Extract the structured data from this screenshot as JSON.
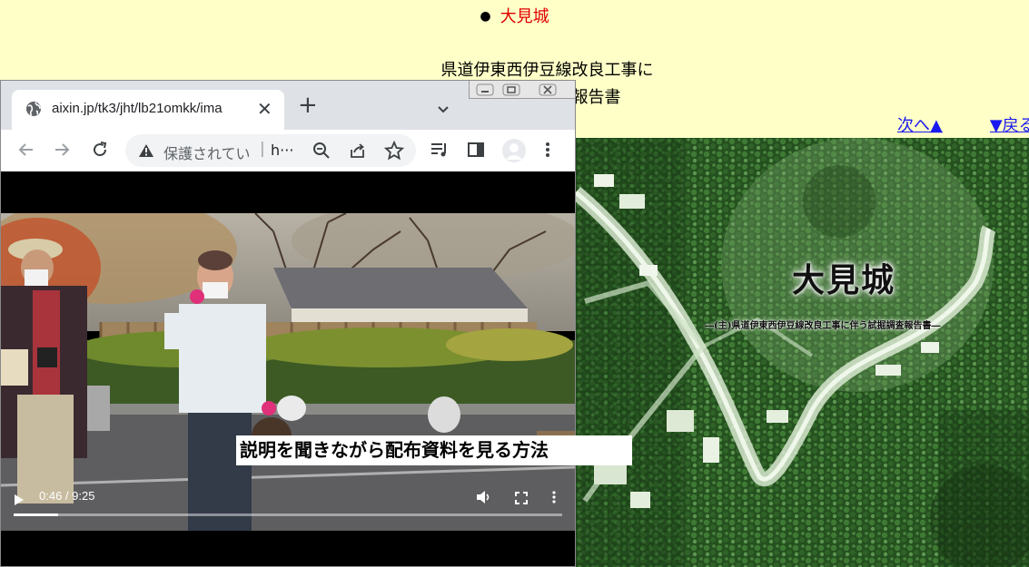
{
  "page": {
    "heading_bullet": "●",
    "heading": "大見城",
    "title_line1": "県道伊東西伊豆線改良工事に",
    "title_line2": "伴う試掘調査報告書",
    "nav_next": "次へ▲",
    "nav_back": "▼戻る"
  },
  "cover": {
    "title": "大見城",
    "subtitle": "―(主)県道伊東西伊豆線改良工事に伴う試掘調査報告書―"
  },
  "browser": {
    "tab": {
      "title": "aixin.jp/tk3/jht/lb21omkk/ima",
      "favicon": "globe-icon"
    },
    "toolbar": {
      "security_label": "保護されてい",
      "url_prefix": "h···"
    },
    "video": {
      "time": "0:46 / 9:25",
      "progress": 0.081
    }
  },
  "caption": "説明を聞きながら配布資料を見る方法",
  "colors": {
    "page_background": "#ffffc8",
    "heading_red": "#e00000",
    "link_blue": "#1a1af0",
    "tabstrip": "#dee1e6",
    "omnibox": "#f1f3f4"
  }
}
